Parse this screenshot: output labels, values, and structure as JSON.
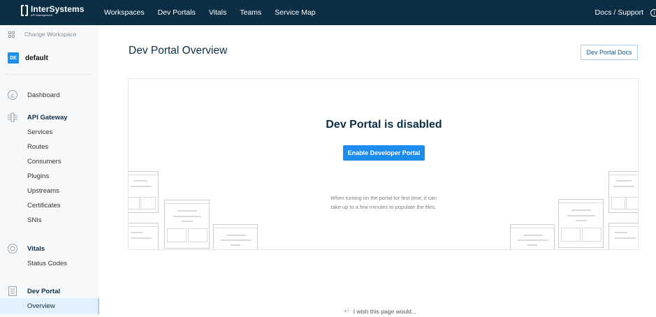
{
  "app": {
    "logo_name": "InterSystems",
    "logo_sub": "API Management"
  },
  "topnav": {
    "items": [
      "Workspaces",
      "Dev Portals",
      "Vitals",
      "Teams",
      "Service Map"
    ],
    "docs_support": "Docs / Support"
  },
  "sidebar": {
    "change_workspace": "Change Workspace",
    "workspace_badge": "DE",
    "workspace_name": "default",
    "dashboard": "Dashboard",
    "api_gateway": "API Gateway",
    "gateway_items": [
      "Services",
      "Routes",
      "Consumers",
      "Plugins",
      "Upstreams",
      "Certificates",
      "SNIs"
    ],
    "vitals": "Vitals",
    "vitals_items": [
      "Status Codes"
    ],
    "dev_portal": "Dev Portal",
    "dev_portal_active": "Overview"
  },
  "main": {
    "title": "Dev Portal Overview",
    "docs_button": "Dev Portal Docs",
    "card_title": "Dev Portal is disabled",
    "enable_button": "Enable Developer Portal",
    "note_line1": "When turning on the portal for first time, it can",
    "note_line2": "take up to a few minutes to populate the files."
  },
  "feedback": "I wish this page would...",
  "colors": {
    "topbar": "#0b2e45",
    "accent": "#1d8cf0",
    "badge": "#1d90e8"
  }
}
